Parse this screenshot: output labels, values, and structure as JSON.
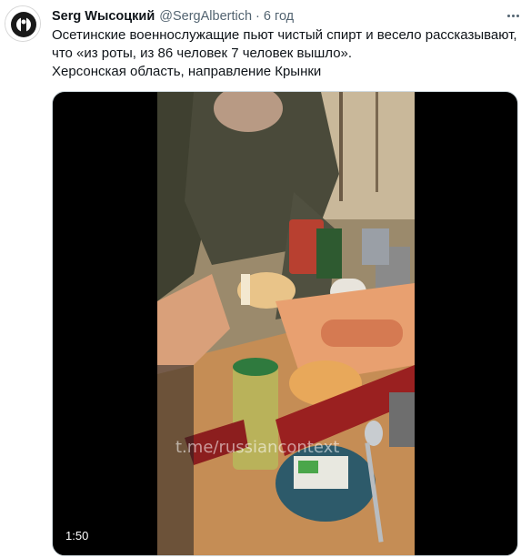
{
  "tweet": {
    "author_name": "Serg Wысоцкий",
    "author_handle": "@SergAlbertich",
    "separator": "·",
    "time": "6 год",
    "text_lines": [
      "Осетинские военнослужащие пьют чистый спирт и весело рассказывают,",
      "что «из роты, из 86 человек 7 человек вышло».",
      "Херсонская область, направление Крынки"
    ],
    "video": {
      "duration": "1:50",
      "watermark": "t.me/russiancontext"
    }
  },
  "icons": {
    "more": "more-horizontal-icon",
    "avatar": "avatar-image"
  }
}
